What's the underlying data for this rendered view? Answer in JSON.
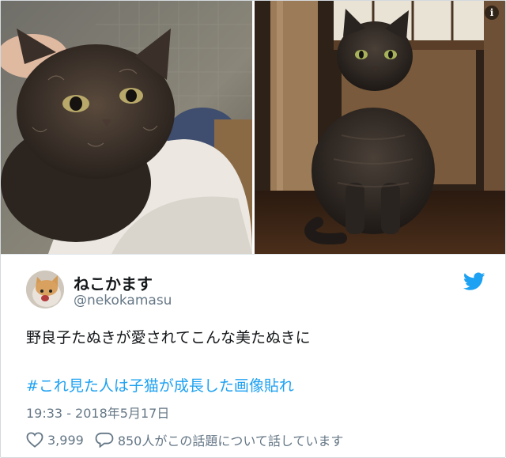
{
  "tweet": {
    "display_name": "ねこかます",
    "handle": "@nekokamasu",
    "text": "野良子たぬきが愛されてこんな美たぬきに",
    "hashtag": "#これ見た人は子猫が成長した画像貼れ",
    "timestamp": "19:33 - 2018年5月17日",
    "likes": "3,999",
    "replies_text": "850人がこの話題について話しています"
  },
  "icons": {
    "info": "info-icon",
    "brand": "twitter-bird-icon",
    "like": "heart-icon",
    "reply": "speech-bubble-icon"
  },
  "colors": {
    "link": "#1da1f2",
    "secondary_text": "#657786",
    "primary_text": "#14171a",
    "border": "#d4d9dd"
  }
}
